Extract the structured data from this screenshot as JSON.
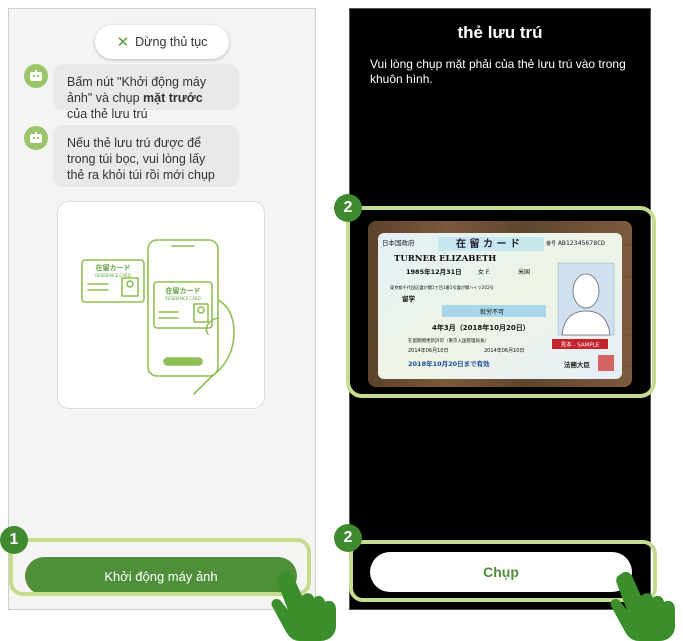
{
  "left": {
    "stop_button": "Dừng thủ tục",
    "msg1_part1": "Bấm nút \"Khởi động máy ảnh\" và chụp ",
    "msg1_bold": "mặt trước",
    "msg1_part2": " của thẻ lưu trú",
    "msg2": "Nếu thẻ lưu trú được để trong túi bọc, vui lòng lấy thẻ ra khỏi túi rồi mới chụp",
    "illus_card_jp": "在留カード",
    "illus_card_en": "RESIDENCE CARD",
    "start_button": "Khởi động máy ảnh",
    "step": "1"
  },
  "right": {
    "title": "thẻ lưu trú",
    "instruction": "Vui lòng chụp mặt phải của thẻ lưu trú vào trong khuôn hình.",
    "capture_button": "Chụp",
    "step_card": "2",
    "step_button": "2"
  },
  "residence_card": {
    "issuer": "日本国政府",
    "title": "在 留 カ ー ド",
    "number_label": "番号",
    "number": "AB12345678CD",
    "name": "TURNER ELIZABETH",
    "dob": "1985年12月31日",
    "sex": "女 F.",
    "nationality": "米国",
    "address": "東京都千代田区霞が関1丁目1番1号霞が関ハイツ202号",
    "status": "留学",
    "work_permit": "就労不可",
    "period": "4年3月（2018年10月20日）",
    "permit_type": "在留期間更新許可（東京入国管理局長）",
    "permit_date": "2014年06月10日",
    "issue_date": "2014年06月10日",
    "expiry": "2018年10月20日まで有効",
    "sample": "見本 - SAMPLE",
    "seal": "法務大臣"
  },
  "colors": {
    "brand_green": "#4f8f3a",
    "highlight": "#c5dc8f",
    "step_green": "#3f8a2e",
    "bubble": "#e9e9e7"
  }
}
